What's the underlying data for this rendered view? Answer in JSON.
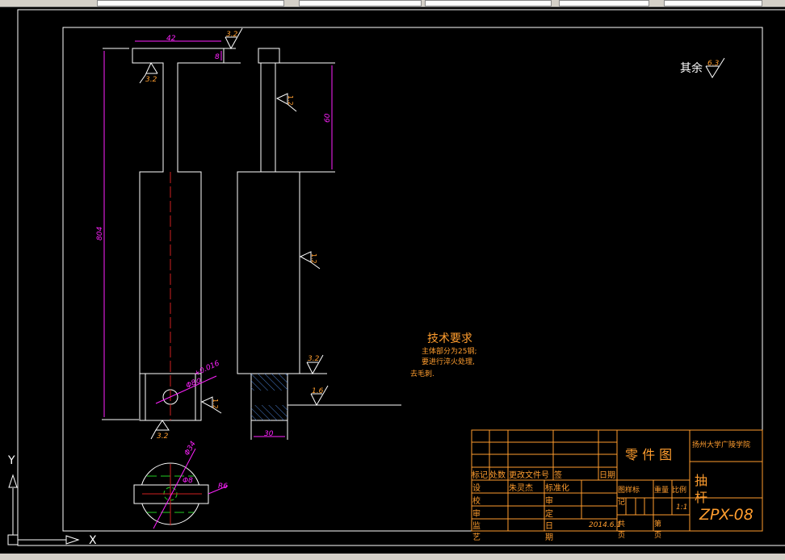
{
  "window": {
    "toolbar_icons": [
      "layer-icon",
      "properties-icon"
    ]
  },
  "drawing": {
    "dimensions": {
      "top_width": "42",
      "head_height": "8",
      "total_length": "804",
      "stem_length": "60",
      "section_width": "30",
      "hole_dia": "Φ8",
      "hole_tol_upper": "+0.016",
      "hole_tol_lower": "0",
      "circle_dia": "Φ34",
      "circle_hole": "Φ8",
      "radius": "R6"
    },
    "roughness": {
      "r1": "3.2",
      "r2": "3.2",
      "r3": "3.2",
      "r4": "3.2",
      "r5": "3.2",
      "r6": "1.6",
      "r7": "1.2",
      "r8": "1.2",
      "r9": "1.2",
      "rest_label": "其余",
      "rest_value": "6.3"
    },
    "notes": {
      "title": "技术要求",
      "line1": "主体部分为25钢;",
      "line2": "要进行淬火处理,",
      "line3": "去毛刺."
    }
  },
  "title_block": {
    "headers": [
      "标记",
      "处数",
      "更改文件号",
      "签",
      "日期"
    ],
    "roles": [
      "设",
      "校",
      "审",
      "监",
      "艺"
    ],
    "designer": "朱灵杰",
    "std_label": "标准化",
    "review_label": "审",
    "approve_label": "定",
    "date_label1": "日",
    "date_label2": "期",
    "date": "2014.6.1",
    "drawing_type": "零 件 图",
    "school": "扬州大学广陵学院",
    "part_name1": "抽",
    "part_name2": "杆",
    "stage_label": "图样标",
    "stage_label2": "记",
    "weight_label": "重量",
    "scale_label": "比例",
    "scale": "1:1",
    "total_label": "共",
    "sheet_label": "第",
    "page_label": "页",
    "drawing_no": "ZPX-08"
  },
  "ucs": {
    "x": "X",
    "y": "Y"
  }
}
